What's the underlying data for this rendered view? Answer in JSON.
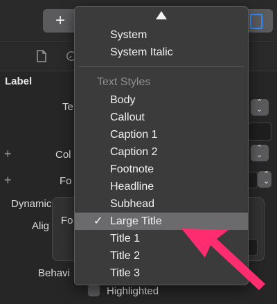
{
  "toolbar": {
    "add_icon": "plus-icon",
    "library_icon": "library-icon"
  },
  "tabs": [
    {
      "icon": "file-icon"
    },
    {
      "icon": "clock-icon"
    }
  ],
  "inspector": {
    "section": "Label",
    "rows": [
      {
        "label": "Te"
      },
      {
        "label": "Col"
      },
      {
        "label": "Fo"
      },
      {
        "label": "Dynamic T"
      },
      {
        "label": "Alig"
      },
      {
        "label": "Fo"
      },
      {
        "label": "Behavi"
      }
    ],
    "highlighted_checkbox": "Highlighted"
  },
  "menu": {
    "items_top": [
      "System",
      "System Italic"
    ],
    "header": "Text Styles",
    "items": [
      "Body",
      "Callout",
      "Caption 1",
      "Caption 2",
      "Footnote",
      "Headline",
      "Subhead",
      "Large Title",
      "Title 1",
      "Title 2",
      "Title 3"
    ],
    "selected": "Large Title",
    "checkmark": "✓"
  },
  "colors": {
    "annotation": "#ff2d6f",
    "accent": "#2f8cff"
  }
}
